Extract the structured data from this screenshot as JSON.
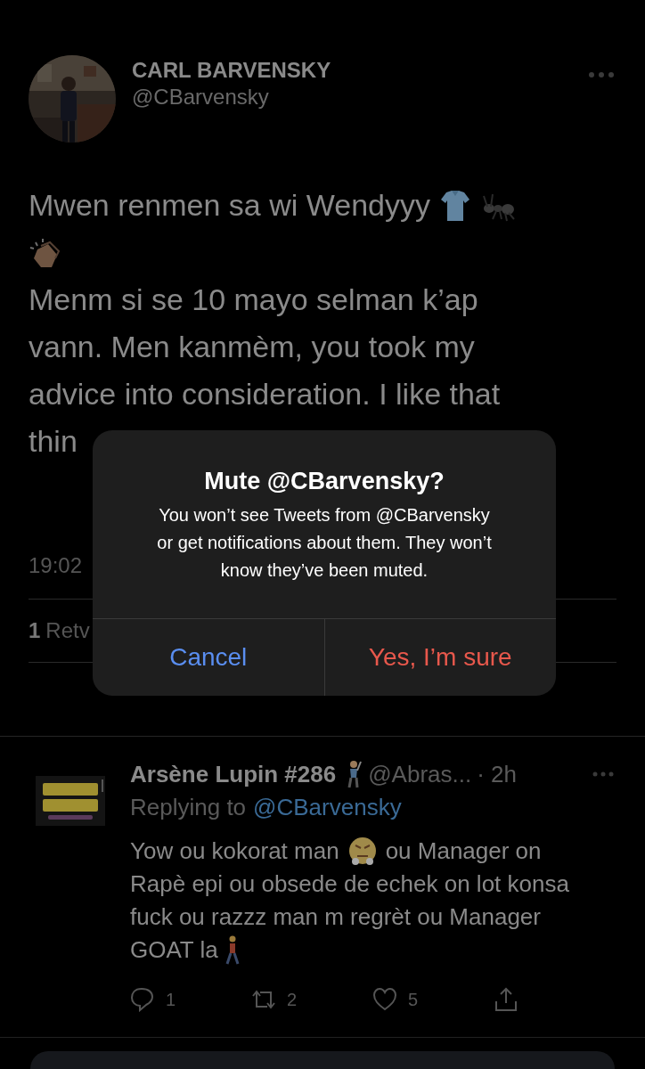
{
  "tweet": {
    "name": "CARL BARVENSKY",
    "handle": "@CBarvensky",
    "body_lines": [
      "Mwen renmen sa wi Wendyyy",
      "Menm si se 10 mayo selman k’ap",
      "vann. Men kanmèm, you took my",
      "advice into consideration. I like that",
      "thin"
    ],
    "time": "19:02",
    "retweet_count": "1",
    "retweet_label": "Retv"
  },
  "dialog": {
    "title": "Mute @CBarvensky?",
    "message": "You won’t see Tweets from @CBarvensky or get notifications about them. They won’t know they’ve been muted.",
    "buttons": [
      {
        "label": "Cancel",
        "kind": "cancel"
      },
      {
        "label": "Yes, I’m sure",
        "kind": "destructive"
      }
    ]
  },
  "reply": {
    "name": "Arsène Lupin #286",
    "handle": "@Abras...",
    "age": "· 2h",
    "replying_label": "Replying to",
    "replying_handle": "@CBarvensky",
    "body_lines": [
      "Yow ou kokorat man",
      "ou Manager on",
      "Rapè epi ou obsede de echek on lot konsa",
      "fuck ou razzz man m regrèt ou Manager",
      "GOAT la"
    ],
    "actions": [
      {
        "kind": "reply",
        "count": "1"
      },
      {
        "kind": "retweet",
        "count": "2"
      },
      {
        "kind": "like",
        "count": "5"
      },
      {
        "kind": "share"
      }
    ]
  }
}
